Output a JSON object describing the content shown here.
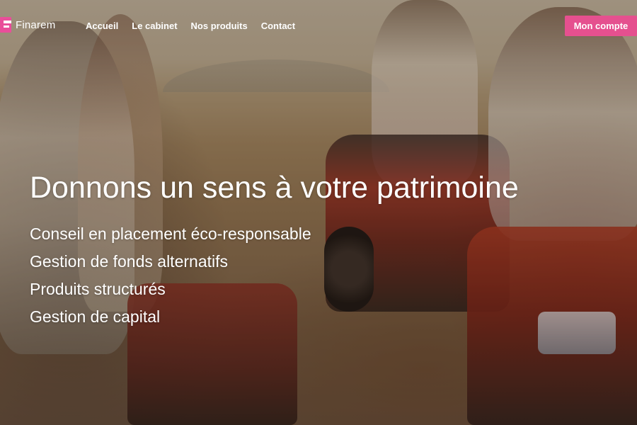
{
  "brand": {
    "name": "Finarem",
    "accent_color": "#e5508f"
  },
  "nav": {
    "items": [
      {
        "label": "Accueil"
      },
      {
        "label": "Le cabinet"
      },
      {
        "label": "Nos produits"
      },
      {
        "label": "Contact"
      }
    ],
    "account_button": "Mon compte"
  },
  "hero": {
    "title": "Donnons un sens à votre patrimoine",
    "services": [
      "Conseil en placement éco-responsable",
      "Gestion de fonds alternatifs",
      "Produits structurés",
      "Gestion de capital"
    ]
  }
}
